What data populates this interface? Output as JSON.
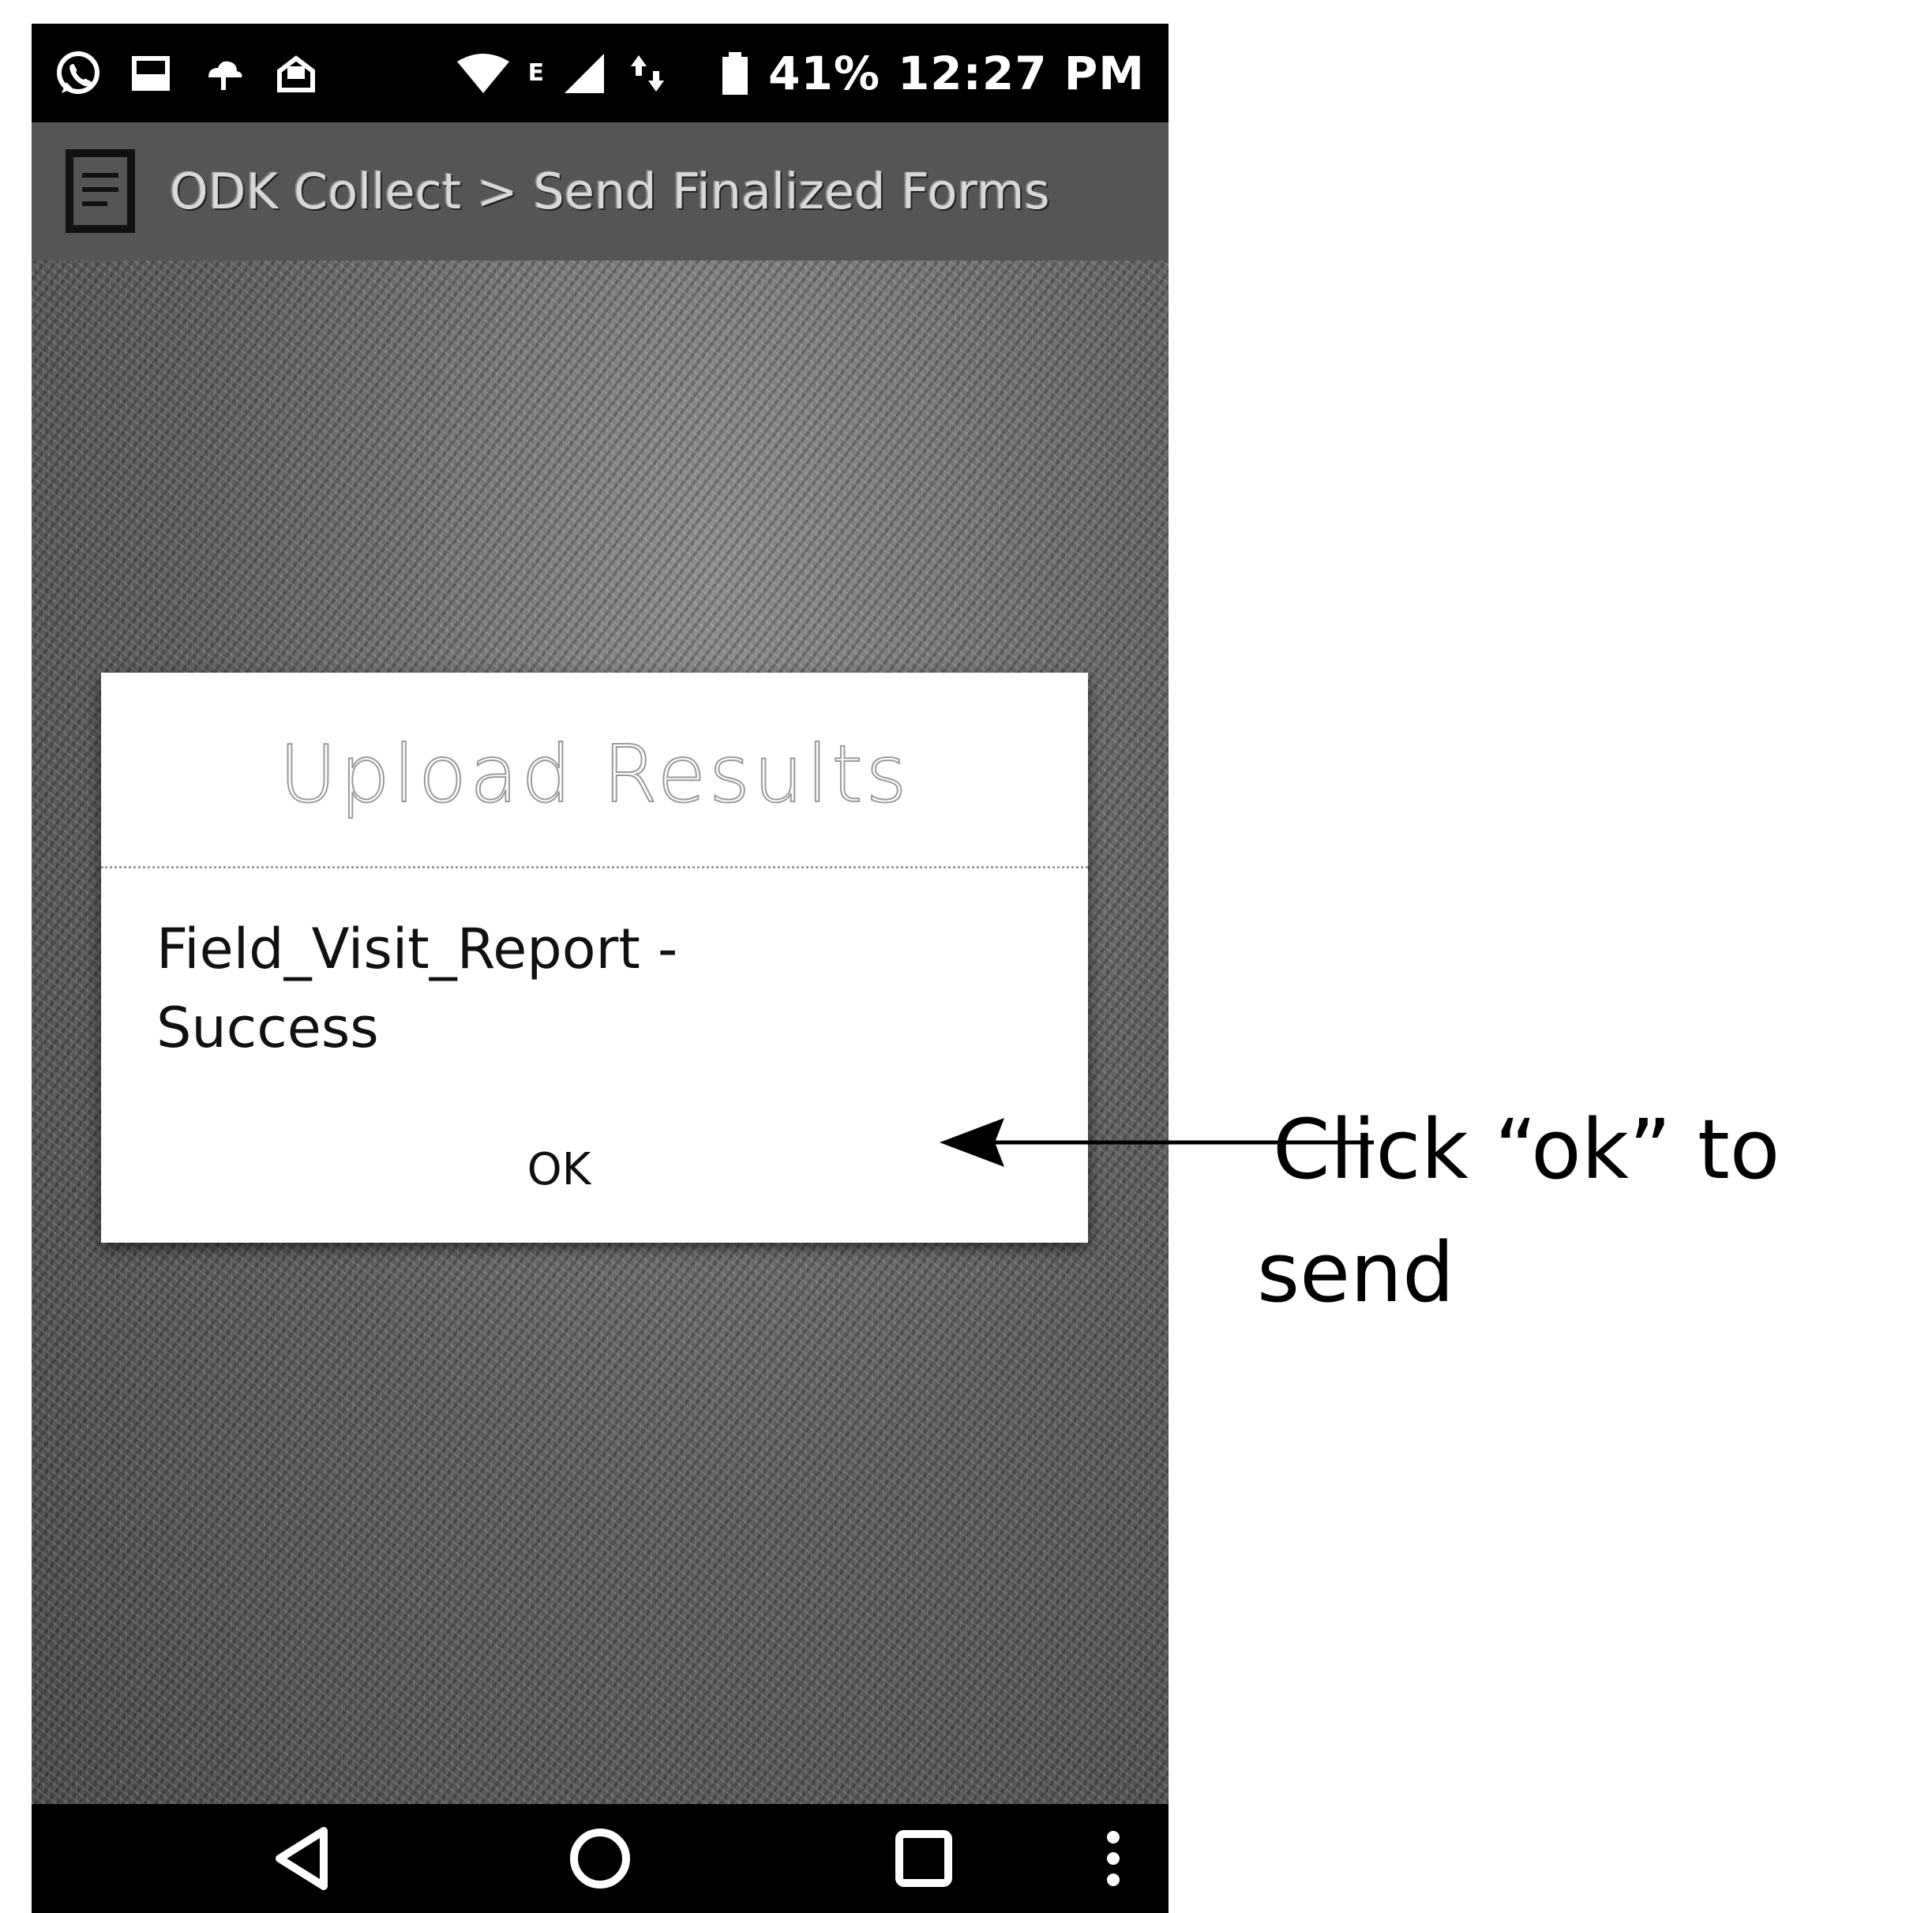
{
  "status_bar": {
    "network_type": "E",
    "battery_percent": "41%",
    "time": "12:27 PM",
    "icons": [
      "whatsapp-icon",
      "gallery-icon",
      "cloud-icon",
      "mail-icon",
      "wifi-icon",
      "signal-icon",
      "data-transfer-icon",
      "battery-icon"
    ]
  },
  "app_bar": {
    "title": "ODK Collect > Send Finalized Forms",
    "icon": "odk-app-icon"
  },
  "dialog": {
    "title": "Upload Results",
    "message_line1": "Field_Visit_Report -",
    "message_line2": "Success",
    "ok_label": "OK"
  },
  "nav_bar": {
    "icons": [
      "back-icon",
      "home-icon",
      "recents-icon",
      "overflow-menu-icon"
    ]
  },
  "annotation": {
    "line1": "Click “ok” to",
    "line2": "send"
  },
  "colors": {
    "status_bar": "#000000",
    "app_bar": "#555555",
    "dialog_bg": "#ffffff",
    "nav_bar": "#000000"
  }
}
